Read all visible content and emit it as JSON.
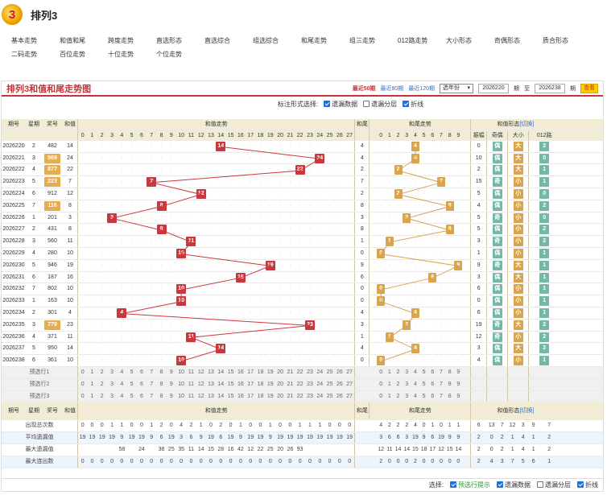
{
  "app": {
    "title": "排列3",
    "logo_text": "3"
  },
  "nav": [
    [
      "基本走势",
      "和值和尾",
      "跨度走势",
      "直选形态",
      "直选综合",
      "组选综合",
      "和尾走势",
      "组三走势",
      "012路走势",
      "大小形态",
      "奇偶形态",
      "质合形态"
    ],
    [
      "二码走势",
      "百位走势",
      "十位走势",
      "个位走势"
    ]
  ],
  "panel": {
    "title": "排列3和值和尾走势图",
    "range": [
      "最近50期",
      "最近80期",
      "最近120期"
    ],
    "select": "选年份",
    "from_issue": "2026220",
    "to": "至",
    "to_issue": "2026238",
    "unit": "期",
    "query": "查看"
  },
  "options": {
    "label": "标注形式选择:",
    "items": [
      {
        "label": "遗漏数据",
        "on": true
      },
      {
        "label": "遗漏分层",
        "on": false
      },
      {
        "label": "折线",
        "on": true
      }
    ]
  },
  "headers": {
    "issue": "期号",
    "week": "星期",
    "prize": "奖号",
    "sum": "和值",
    "sum_trend": "和值走势",
    "tail": "和尾",
    "tail_trend": "和尾走势",
    "form": "和值形态",
    "switch": "[切换]",
    "cols": [
      "振幅",
      "奇偶",
      "大小",
      "012路"
    ],
    "nums": [
      "0",
      "1",
      "2",
      "3",
      "4",
      "5",
      "6",
      "7",
      "8",
      "9",
      "10",
      "11",
      "12",
      "13",
      "14",
      "15",
      "16",
      "17",
      "18",
      "19",
      "20",
      "21",
      "22",
      "23",
      "24",
      "25",
      "26",
      "27"
    ]
  },
  "rows": [
    {
      "issue": "2026220",
      "week": "2",
      "prize": "482",
      "sum": "14",
      "tail": "4",
      "amp": "0",
      "oe": "偶",
      "bs": "大",
      "r": "2"
    },
    {
      "issue": "2026221",
      "week": "3",
      "prize": "969",
      "sum": "24",
      "tail": "4",
      "amp": "10",
      "oe": "偶",
      "bs": "大",
      "r": "0"
    },
    {
      "issue": "2026222",
      "week": "4",
      "prize": "877",
      "sum": "22",
      "tail": "2",
      "amp": "2",
      "oe": "偶",
      "bs": "大",
      "r": "1"
    },
    {
      "issue": "2026223",
      "week": "5",
      "prize": "223",
      "sum": "7",
      "tail": "7",
      "amp": "15",
      "oe": "奇",
      "bs": "小",
      "r": "1"
    },
    {
      "issue": "2026224",
      "week": "6",
      "prize": "912",
      "sum": "12",
      "tail": "2",
      "amp": "5",
      "oe": "偶",
      "bs": "小",
      "r": "0"
    },
    {
      "issue": "2026225",
      "week": "7",
      "prize": "116",
      "sum": "8",
      "tail": "8",
      "amp": "4",
      "oe": "偶",
      "bs": "小",
      "r": "2"
    },
    {
      "issue": "2026226",
      "week": "1",
      "prize": "201",
      "sum": "3",
      "tail": "3",
      "amp": "5",
      "oe": "奇",
      "bs": "小",
      "r": "0"
    },
    {
      "issue": "2026227",
      "week": "2",
      "prize": "431",
      "sum": "8",
      "tail": "8",
      "amp": "5",
      "oe": "偶",
      "bs": "小",
      "r": "2"
    },
    {
      "issue": "2026228",
      "week": "3",
      "prize": "560",
      "sum": "11",
      "tail": "1",
      "amp": "3",
      "oe": "奇",
      "bs": "小",
      "r": "2"
    },
    {
      "issue": "2026229",
      "week": "4",
      "prize": "280",
      "sum": "10",
      "tail": "0",
      "amp": "1",
      "oe": "偶",
      "bs": "小",
      "r": "1"
    },
    {
      "issue": "2026230",
      "week": "5",
      "prize": "946",
      "sum": "19",
      "tail": "9",
      "amp": "9",
      "oe": "奇",
      "bs": "大",
      "r": "1"
    },
    {
      "issue": "2026231",
      "week": "6",
      "prize": "187",
      "sum": "16",
      "tail": "6",
      "amp": "3",
      "oe": "偶",
      "bs": "大",
      "r": "1"
    },
    {
      "issue": "2026232",
      "week": "7",
      "prize": "802",
      "sum": "10",
      "tail": "0",
      "amp": "6",
      "oe": "偶",
      "bs": "小",
      "r": "1"
    },
    {
      "issue": "2026233",
      "week": "1",
      "prize": "163",
      "sum": "10",
      "tail": "0",
      "amp": "0",
      "oe": "偶",
      "bs": "小",
      "r": "1"
    },
    {
      "issue": "2026234",
      "week": "2",
      "prize": "301",
      "sum": "4",
      "tail": "4",
      "amp": "6",
      "oe": "偶",
      "bs": "小",
      "r": "1"
    },
    {
      "issue": "2026235",
      "week": "3",
      "prize": "779",
      "sum": "23",
      "tail": "3",
      "amp": "19",
      "oe": "奇",
      "bs": "大",
      "r": "2"
    },
    {
      "issue": "2026236",
      "week": "4",
      "prize": "371",
      "sum": "11",
      "tail": "1",
      "amp": "12",
      "oe": "奇",
      "bs": "小",
      "r": "2"
    },
    {
      "issue": "2026237",
      "week": "5",
      "prize": "950",
      "sum": "14",
      "tail": "4",
      "amp": "3",
      "oe": "偶",
      "bs": "大",
      "r": "2"
    },
    {
      "issue": "2026238",
      "week": "6",
      "prize": "361",
      "sum": "10",
      "tail": "0",
      "amp": "4",
      "oe": "偶",
      "bs": "小",
      "r": "1"
    }
  ],
  "preview": [
    "预选行1",
    "预选行2",
    "预选行3"
  ],
  "stats": [
    {
      "label": "出现总次数",
      "sum": [
        "0",
        "0",
        "0",
        "1",
        "1",
        "0",
        "0",
        "1",
        "2",
        "0",
        "4",
        "2",
        "1",
        "0",
        "2",
        "0",
        "1",
        "0",
        "0",
        "1",
        "0",
        "0",
        "1",
        "1",
        "1",
        "0",
        "0",
        "0"
      ],
      "tail": [
        "4",
        "2",
        "2",
        "2",
        "4",
        "0",
        "1",
        "0",
        "1",
        "1"
      ],
      "form": [
        "6",
        "13",
        "7",
        "12",
        "3",
        "9",
        "7"
      ]
    },
    {
      "label": "平均遗漏值",
      "sum": [
        "19",
        "19",
        "19",
        "19",
        "9",
        "19",
        "19",
        "9",
        "6",
        "19",
        "3",
        "6",
        "9",
        "19",
        "6",
        "19",
        "9",
        "19",
        "19",
        "9",
        "19",
        "19",
        "19",
        "19",
        "19",
        "19",
        "19",
        "19"
      ],
      "tail": [
        "3",
        "6",
        "6",
        "3",
        "19",
        "9",
        "6",
        "19",
        "9",
        "9"
      ],
      "form": [
        "2",
        "0",
        "2",
        "1",
        "4",
        "1",
        "2"
      ]
    },
    {
      "label": "最大遗漏值",
      "sum": [
        "",
        "",
        "",
        "",
        "58",
        "",
        "24",
        "",
        "38",
        "25",
        "35",
        "11",
        "14",
        "15",
        "28",
        "16",
        "42",
        "12",
        "22",
        "25",
        "20",
        "26",
        "93",
        "",
        "",
        "",
        "",
        ""
      ],
      "tail": [
        "12",
        "11",
        "14",
        "14",
        "15",
        "18",
        "17",
        "12",
        "15",
        "14"
      ],
      "form": [
        "2",
        "0",
        "2",
        "1",
        "4",
        "1",
        "2"
      ]
    },
    {
      "label": "最大连出数",
      "sum": [
        "0",
        "0",
        "0",
        "0",
        "0",
        "0",
        "0",
        "0",
        "0",
        "0",
        "0",
        "0",
        "0",
        "0",
        "0",
        "0",
        "0",
        "0",
        "0",
        "0",
        "0",
        "0",
        "0",
        "0",
        "0",
        "0",
        "0",
        "0"
      ],
      "tail": [
        "2",
        "0",
        "0",
        "0",
        "2",
        "0",
        "0",
        "0",
        "0",
        "0"
      ],
      "form": [
        "2",
        "4",
        "3",
        "7",
        "5",
        "6",
        "1"
      ]
    }
  ],
  "footer": {
    "label": "选择:",
    "items": [
      {
        "label": "预选行提示",
        "on": true
      },
      {
        "label": "遗漏数据",
        "on": true
      },
      {
        "label": "遗漏分层",
        "on": false
      },
      {
        "label": "折线",
        "on": true
      }
    ]
  }
}
